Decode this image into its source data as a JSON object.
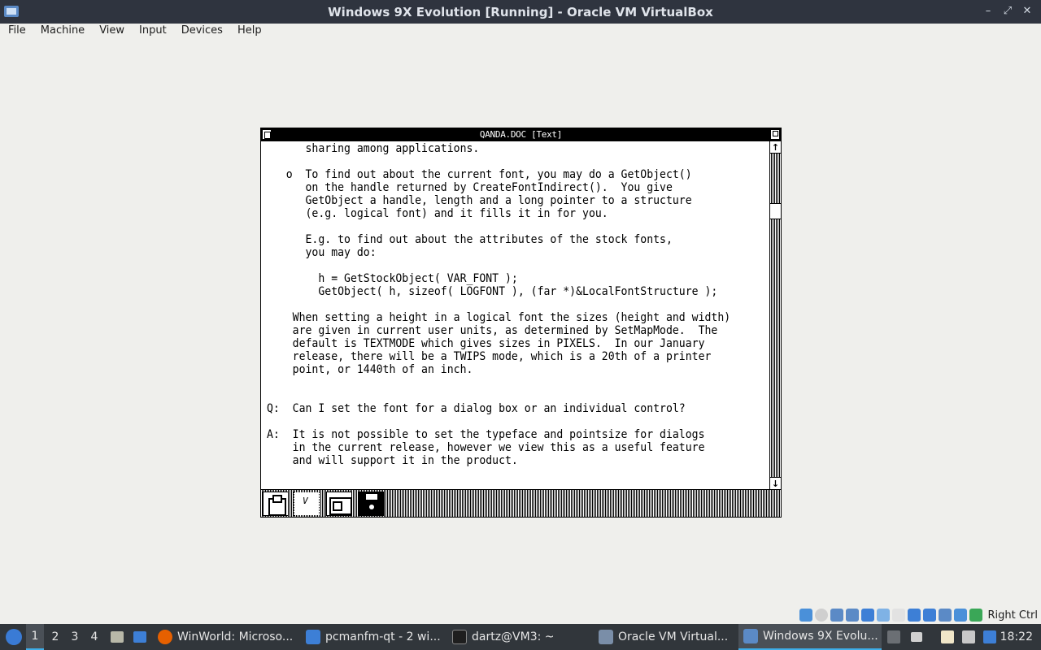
{
  "vbox": {
    "window_title": "Windows 9X Evolution [Running] - Oracle VM VirtualBox",
    "menus": [
      "File",
      "Machine",
      "View",
      "Input",
      "Devices",
      "Help"
    ],
    "host_key": "Right Ctrl",
    "window_controls": {
      "minimize": "–",
      "maximize": "⤢",
      "close": "✕"
    }
  },
  "document": {
    "title": "QANDA.DOC [Text]",
    "lines": [
      "      sharing among applications.",
      "",
      "   o  To find out about the current font, you may do a GetObject()",
      "      on the handle returned by CreateFontIndirect().  You give",
      "      GetObject a handle, length and a long pointer to a structure",
      "      (e.g. logical font) and it fills it in for you.",
      "",
      "      E.g. to find out about the attributes of the stock fonts,",
      "      you may do:",
      "",
      "        h = GetStockObject( VAR_FONT );",
      "        GetObject( h, sizeof( LOGFONT ), (far *)&LocalFontStructure );",
      "",
      "    When setting a height in a logical font the sizes (height and width)",
      "    are given in current user units, as determined by SetMapMode.  The",
      "    default is TEXTMODE which gives sizes in PIXELS.  In our January",
      "    release, there will be a TWIPS mode, which is a 20th of a printer",
      "    point, or 1440th of an inch.",
      "",
      "",
      "Q:  Can I set the font for a dialog box or an individual control?",
      "",
      "A:  It is not possible to set the typeface and pointsize for dialogs",
      "    in the current release, however we view this as a useful feature",
      "    and will support it in the product."
    ],
    "scroll_arrows": {
      "up": "↑",
      "down": "↓"
    },
    "icon_area": [
      "clipboard-icon",
      "clock-icon",
      "ms-dos-executive-icon",
      "floppy-disk-icon"
    ],
    "clock_glyph": "V"
  },
  "taskbar": {
    "workspaces": [
      "1",
      "2",
      "3",
      "4"
    ],
    "tasks": [
      {
        "label": "WinWorld: Microso...",
        "icon": "firefox-icon",
        "color": "#e66000"
      },
      {
        "label": "pcmanfm-qt - 2 wi...",
        "icon": "folder-icon",
        "color": "#3d7fd6"
      },
      {
        "label": "dartz@VM3: ~",
        "icon": "terminal-icon",
        "color": "#2b2b2b"
      },
      {
        "label": "Oracle VM Virtual...",
        "icon": "virtualbox-icon",
        "color": "#7a8ea8"
      },
      {
        "label": "Windows 9X Evolu...",
        "icon": "virtualbox-vm-icon",
        "color": "#5b8ac6"
      }
    ],
    "clock": "18:22"
  }
}
